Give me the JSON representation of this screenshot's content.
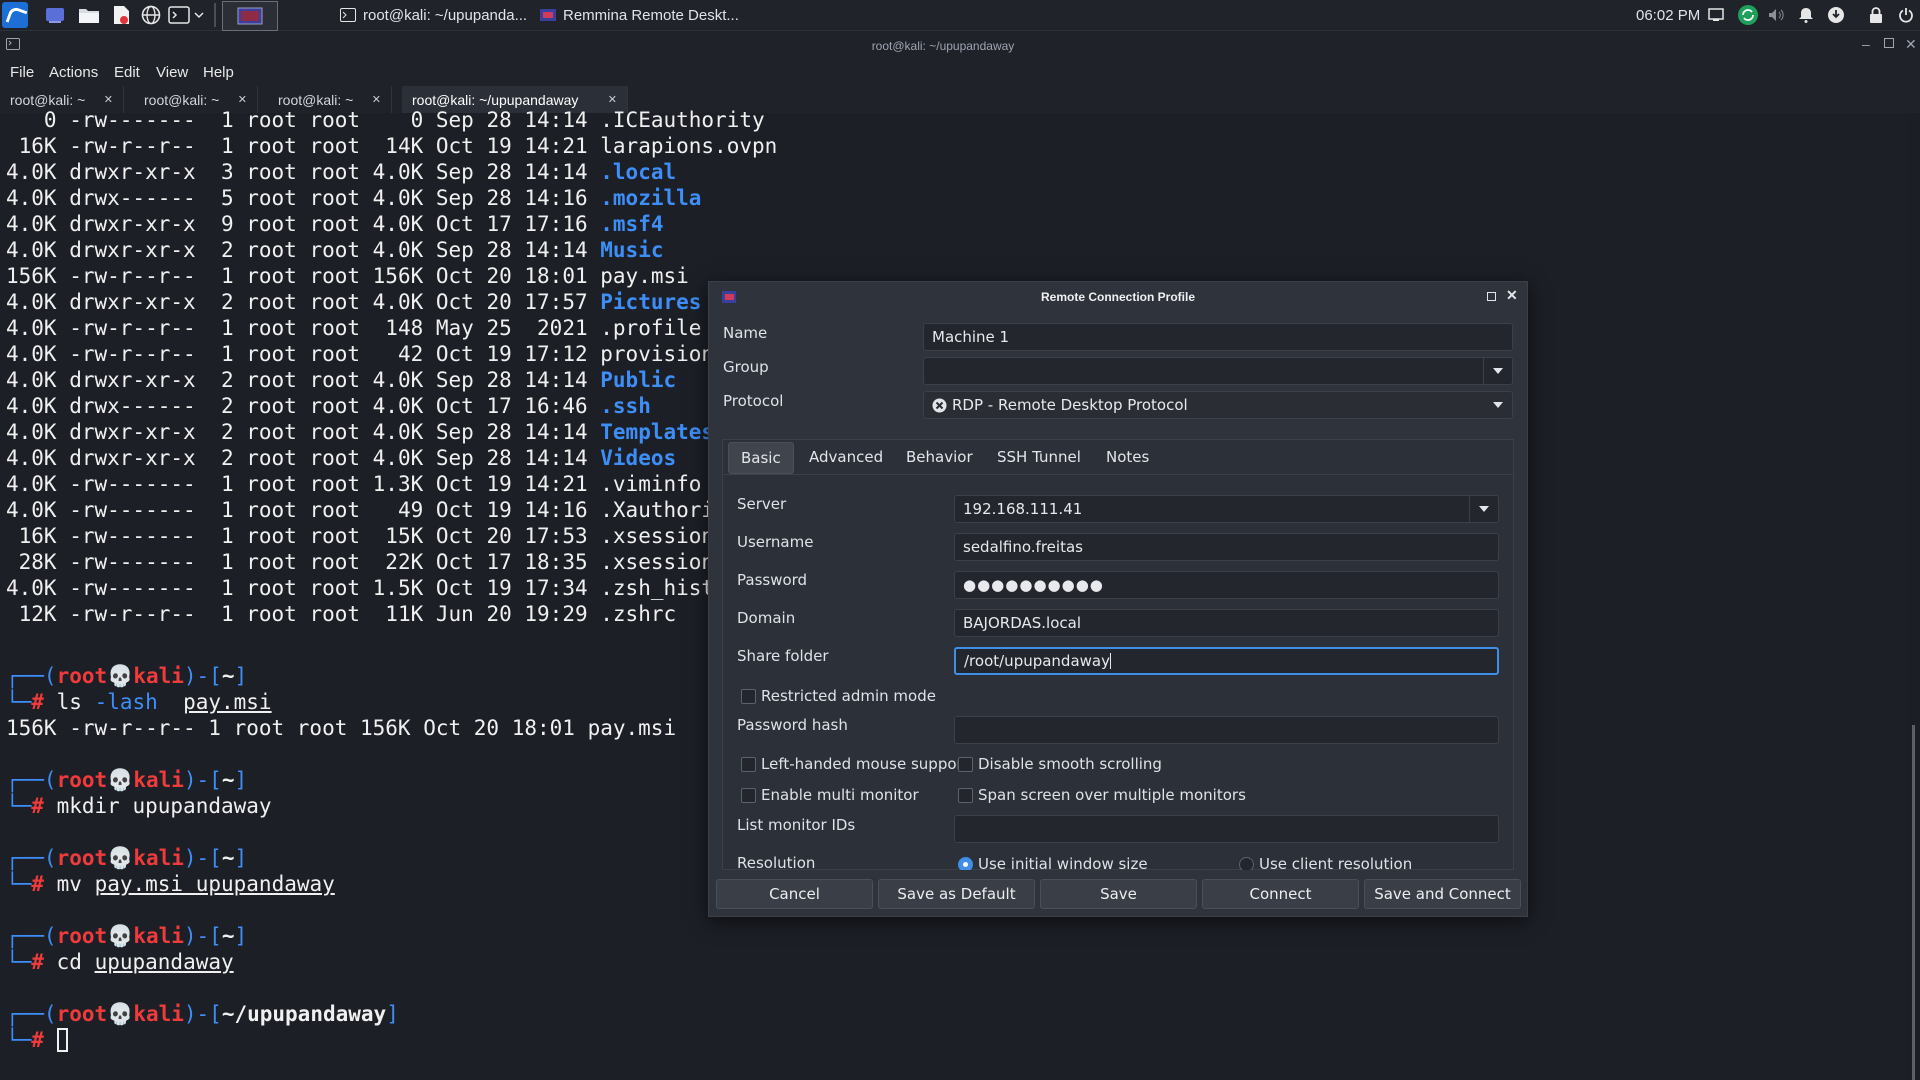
{
  "panel": {
    "taskbar_items": [
      {
        "icon": "terminal-icon",
        "label": "root@kali: ~/upupanda..."
      },
      {
        "icon": "remmina-icon",
        "label": "Remmina Remote Deskt..."
      }
    ],
    "clock": "06:02 PM"
  },
  "terminal": {
    "title": "root@kali: ~/upupandaway",
    "menu": [
      "File",
      "Actions",
      "Edit",
      "View",
      "Help"
    ],
    "tabs": [
      {
        "label": "root@kali: ~"
      },
      {
        "label": "root@kali: ~"
      },
      {
        "label": "root@kali: ~"
      },
      {
        "label": "root@kali: ~/upupandaway",
        "active": true
      }
    ],
    "listing": [
      {
        "size": "   0",
        "perms": "-rw-------",
        "links": "1",
        "owner": "root",
        "group": "root",
        "fsize": "   0",
        "date": "Sep 28 14:14",
        "name": ".ICEauthority",
        "dir": false
      },
      {
        "size": " 16K",
        "perms": "-rw-r--r--",
        "links": "1",
        "owner": "root",
        "group": "root",
        "fsize": " 14K",
        "date": "Oct 19 14:21",
        "name": "larapions.ovpn",
        "dir": false
      },
      {
        "size": "4.0K",
        "perms": "drwxr-xr-x",
        "links": "3",
        "owner": "root",
        "group": "root",
        "fsize": "4.0K",
        "date": "Sep 28 14:14",
        "name": ".local",
        "dir": true
      },
      {
        "size": "4.0K",
        "perms": "drwx------",
        "links": "5",
        "owner": "root",
        "group": "root",
        "fsize": "4.0K",
        "date": "Sep 28 14:16",
        "name": ".mozilla",
        "dir": true
      },
      {
        "size": "4.0K",
        "perms": "drwxr-xr-x",
        "links": "9",
        "owner": "root",
        "group": "root",
        "fsize": "4.0K",
        "date": "Oct 17 17:16",
        "name": ".msf4",
        "dir": true
      },
      {
        "size": "4.0K",
        "perms": "drwxr-xr-x",
        "links": "2",
        "owner": "root",
        "group": "root",
        "fsize": "4.0K",
        "date": "Sep 28 14:14",
        "name": "Music",
        "dir": true
      },
      {
        "size": "156K",
        "perms": "-rw-r--r--",
        "links": "1",
        "owner": "root",
        "group": "root",
        "fsize": "156K",
        "date": "Oct 20 18:01",
        "name": "pay.msi",
        "dir": false
      },
      {
        "size": "4.0K",
        "perms": "drwxr-xr-x",
        "links": "2",
        "owner": "root",
        "group": "root",
        "fsize": "4.0K",
        "date": "Oct 20 17:57",
        "name": "Pictures",
        "dir": true
      },
      {
        "size": "4.0K",
        "perms": "-rw-r--r--",
        "links": "1",
        "owner": "root",
        "group": "root",
        "fsize": " 148",
        "date": "May 25  2021",
        "name": ".profile",
        "dir": false
      },
      {
        "size": "4.0K",
        "perms": "-rw-r--r--",
        "links": "1",
        "owner": "root",
        "group": "root",
        "fsize": "  42",
        "date": "Oct 19 17:12",
        "name": "provisionUse",
        "dir": false
      },
      {
        "size": "4.0K",
        "perms": "drwxr-xr-x",
        "links": "2",
        "owner": "root",
        "group": "root",
        "fsize": "4.0K",
        "date": "Sep 28 14:14",
        "name": "Public",
        "dir": true
      },
      {
        "size": "4.0K",
        "perms": "drwx------",
        "links": "2",
        "owner": "root",
        "group": "root",
        "fsize": "4.0K",
        "date": "Oct 17 16:46",
        "name": ".ssh",
        "dir": true
      },
      {
        "size": "4.0K",
        "perms": "drwxr-xr-x",
        "links": "2",
        "owner": "root",
        "group": "root",
        "fsize": "4.0K",
        "date": "Sep 28 14:14",
        "name": "Templates",
        "dir": true
      },
      {
        "size": "4.0K",
        "perms": "drwxr-xr-x",
        "links": "2",
        "owner": "root",
        "group": "root",
        "fsize": "4.0K",
        "date": "Sep 28 14:14",
        "name": "Videos",
        "dir": true
      },
      {
        "size": "4.0K",
        "perms": "-rw-------",
        "links": "1",
        "owner": "root",
        "group": "root",
        "fsize": "1.3K",
        "date": "Oct 19 14:21",
        "name": ".viminfo",
        "dir": false
      },
      {
        "size": "4.0K",
        "perms": "-rw-------",
        "links": "1",
        "owner": "root",
        "group": "root",
        "fsize": "  49",
        "date": "Oct 19 14:16",
        "name": ".Xauthority",
        "dir": false
      },
      {
        "size": " 16K",
        "perms": "-rw-------",
        "links": "1",
        "owner": "root",
        "group": "root",
        "fsize": " 15K",
        "date": "Oct 20 17:53",
        "name": ".xsession-er",
        "dir": false
      },
      {
        "size": " 28K",
        "perms": "-rw-------",
        "links": "1",
        "owner": "root",
        "group": "root",
        "fsize": " 22K",
        "date": "Oct 17 18:35",
        "name": ".xsession-er",
        "dir": false
      },
      {
        "size": "4.0K",
        "perms": "-rw-------",
        "links": "1",
        "owner": "root",
        "group": "root",
        "fsize": "1.5K",
        "date": "Oct 19 17:34",
        "name": ".zsh_history",
        "dir": false
      },
      {
        "size": " 12K",
        "perms": "-rw-r--r--",
        "links": "1",
        "owner": "root",
        "group": "root",
        "fsize": " 11K",
        "date": "Jun 20 19:29",
        "name": ".zshrc",
        "dir": false
      }
    ],
    "prompt_user": "root",
    "prompt_host": "kali",
    "commands": [
      {
        "path": "~",
        "cmd": "ls",
        "args": "-lash",
        "target": "pay.msi",
        "output": "156K -rw-r--r-- 1 root root 156K Oct 20 18:01 pay.msi"
      },
      {
        "path": "~",
        "cmd": "mkdir",
        "args": "",
        "target": "upupandaway",
        "output": ""
      },
      {
        "path": "~",
        "cmd": "mv",
        "args": "",
        "target": "pay.msi upupandaway",
        "output": ""
      },
      {
        "path": "~",
        "cmd": "cd",
        "args": "",
        "target": "upupandaway",
        "output": ""
      }
    ],
    "current_path": "~/upupandaway"
  },
  "dialog": {
    "title": "Remote Connection Profile",
    "name_label": "Name",
    "name_value": "Machine 1",
    "group_label": "Group",
    "group_value": "",
    "protocol_label": "Protocol",
    "protocol_value": "RDP - Remote Desktop Protocol",
    "tabs": [
      "Basic",
      "Advanced",
      "Behavior",
      "SSH Tunnel",
      "Notes"
    ],
    "active_tab": "Basic",
    "server_label": "Server",
    "server_value": "192.168.111.41",
    "username_label": "Username",
    "username_value": "sedalfino.freitas",
    "password_label": "Password",
    "password_value": "●●●●●●●●●●",
    "domain_label": "Domain",
    "domain_value": "BAJORDAS.local",
    "share_label": "Share folder",
    "share_value": "/root/upupandaway",
    "restricted_admin": "Restricted admin mode",
    "hash_label": "Password hash",
    "left_handed": "Left-handed mouse support",
    "disable_smooth": "Disable smooth scrolling",
    "multi_monitor": "Enable multi monitor",
    "span_screen": "Span screen over multiple monitors",
    "monitor_ids_label": "List monitor IDs",
    "resolution_label": "Resolution",
    "res_initial": "Use initial window size",
    "res_client": "Use client resolution",
    "buttons": [
      "Cancel",
      "Save as Default",
      "Save",
      "Connect",
      "Save and Connect"
    ]
  }
}
